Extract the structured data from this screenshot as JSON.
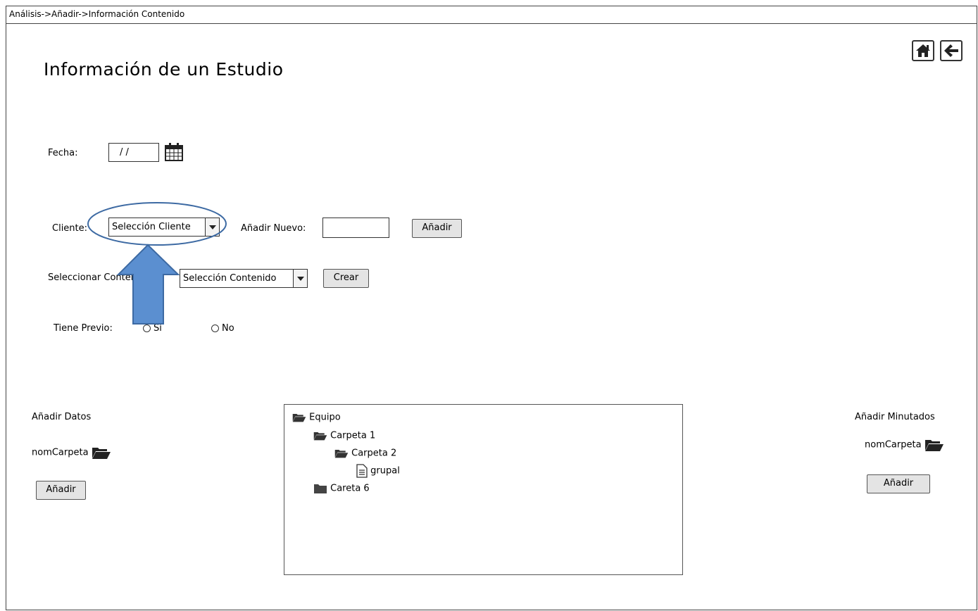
{
  "breadcrumb": "Análisis->Añadir->Información Contenido",
  "page_title": "Información de un Estudio",
  "header_icons": [
    "home-icon",
    "back-arrow-icon"
  ],
  "fecha": {
    "label": "Fecha:",
    "value": "/ /",
    "icon": "calendar-icon"
  },
  "cliente": {
    "label": "Cliente:",
    "select_value": "Selección Cliente",
    "add_new_label": "Añadir Nuevo:",
    "add_new_value": "",
    "add_button": "Añadir"
  },
  "contenido": {
    "label": "Seleccionar Contenido:",
    "select_value": "Selección Contenido",
    "create_button": "Crear"
  },
  "tiene_previo": {
    "label": "Tiene Previo:",
    "options": [
      "Sí",
      "No"
    ]
  },
  "annotation": {
    "highlight": "ellipse",
    "arrow_color": "#5b8fd0",
    "outline_color": "#3d6aa3"
  },
  "datos": {
    "heading": "Añadir Datos",
    "folder_label": "nomCarpeta",
    "button": "Añadir"
  },
  "minutados": {
    "heading": "Añadir Minutados",
    "folder_label": "nomCarpeta",
    "button": "Añadir"
  },
  "tree": {
    "nodes": [
      {
        "label": "Equipo",
        "icon": "folder-open-icon"
      },
      {
        "label": "Carpeta 1",
        "icon": "folder-open-icon"
      },
      {
        "label": "Carpeta 2",
        "icon": "folder-open-icon"
      },
      {
        "label": "grupal",
        "icon": "file-text-icon"
      },
      {
        "label": "Careta 6",
        "icon": "folder-closed-icon"
      }
    ]
  }
}
